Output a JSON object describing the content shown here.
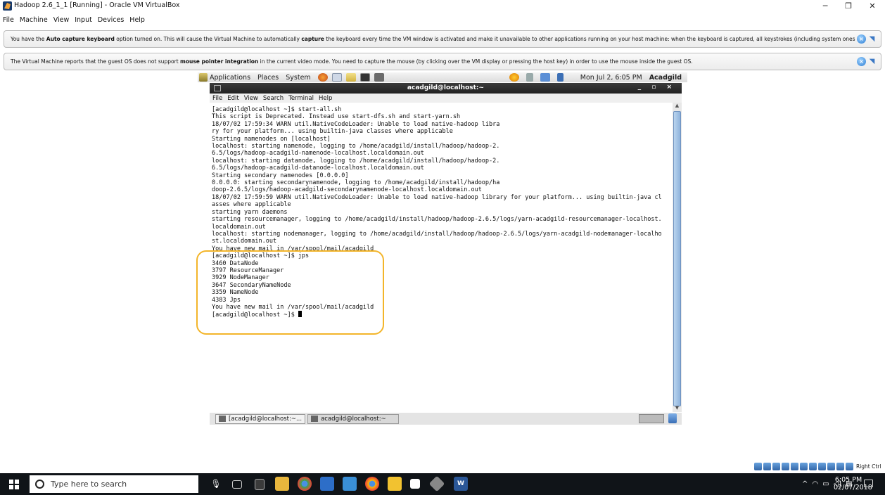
{
  "host_window": {
    "title": "Hadoop 2.6_1_1 [Running] - Oracle VM VirtualBox",
    "minimize": "─",
    "maximize": "❐",
    "close": "✕"
  },
  "host_menu": [
    "File",
    "Machine",
    "View",
    "Input",
    "Devices",
    "Help"
  ],
  "notifications": [
    {
      "pre": "You have the ",
      "bold1": "Auto capture keyboard",
      "mid1": " option turned on. This will cause the Virtual Machine to automatically ",
      "bold2": "capture",
      "post": " the keyboard every time the VM window is activated and make it unavailable to other applications running on your host machine: when the keyboard is captured, all keystrokes (including system ones like"
    },
    {
      "pre": "The Virtual Machine reports that the guest OS does not support ",
      "bold1": "mouse pointer integration",
      "post": " in the current video mode. You need to capture the mouse (by clicking over the VM display or pressing the host key) in order to use the mouse inside the guest OS."
    }
  ],
  "guest_panel": {
    "menus": [
      "Applications",
      "Places",
      "System"
    ],
    "datetime": "Mon Jul  2,  6:05 PM",
    "user": "Acadgild"
  },
  "terminal": {
    "title": "acadgild@localhost:~",
    "menu": [
      "File",
      "Edit",
      "View",
      "Search",
      "Terminal",
      "Help"
    ],
    "lines": [
      "[acadgild@localhost ~]$ start-all.sh",
      "This script is Deprecated. Instead use start-dfs.sh and start-yarn.sh",
      "18/07/02 17:59:34 WARN util.NativeCodeLoader: Unable to load native-hadoop libra",
      "ry for your platform... using builtin-java classes where applicable",
      "Starting namenodes on [localhost]",
      "localhost: starting namenode, logging to /home/acadgild/install/hadoop/hadoop-2.",
      "6.5/logs/hadoop-acadgild-namenode-localhost.localdomain.out",
      "localhost: starting datanode, logging to /home/acadgild/install/hadoop/hadoop-2.",
      "6.5/logs/hadoop-acadgild-datanode-localhost.localdomain.out",
      "Starting secondary namenodes [0.0.0.0]",
      "0.0.0.0: starting secondarynamenode, logging to /home/acadgild/install/hadoop/ha",
      "doop-2.6.5/logs/hadoop-acadgild-secondarynamenode-localhost.localdomain.out",
      "18/07/02 17:59:59 WARN util.NativeCodeLoader: Unable to load native-hadoop library for your platform... using builtin-java cl",
      "asses where applicable",
      "starting yarn daemons",
      "starting resourcemanager, logging to /home/acadgild/install/hadoop/hadoop-2.6.5/logs/yarn-acadgild-resourcemanager-localhost.",
      "localdomain.out",
      "localhost: starting nodemanager, logging to /home/acadgild/install/hadoop/hadoop-2.6.5/logs/yarn-acadgild-nodemanager-localho",
      "st.localdomain.out",
      "You have new mail in /var/spool/mail/acadgild",
      "[acadgild@localhost ~]$ jps",
      "3460 DataNode",
      "3797 ResourceManager",
      "3929 NodeManager",
      "3647 SecondaryNameNode",
      "3359 NameNode",
      "4383 Jps",
      "You have new mail in /var/spool/mail/acadgild",
      "[acadgild@localhost ~]$ "
    ]
  },
  "guest_taskbar": [
    "[acadgild@localhost:~...",
    "acadgild@localhost:~"
  ],
  "vbox_status": {
    "host_key": "Right Ctrl"
  },
  "windows_taskbar": {
    "search_placeholder": "Type here to search",
    "time": "6:05 PM",
    "date": "02/07/2018"
  }
}
